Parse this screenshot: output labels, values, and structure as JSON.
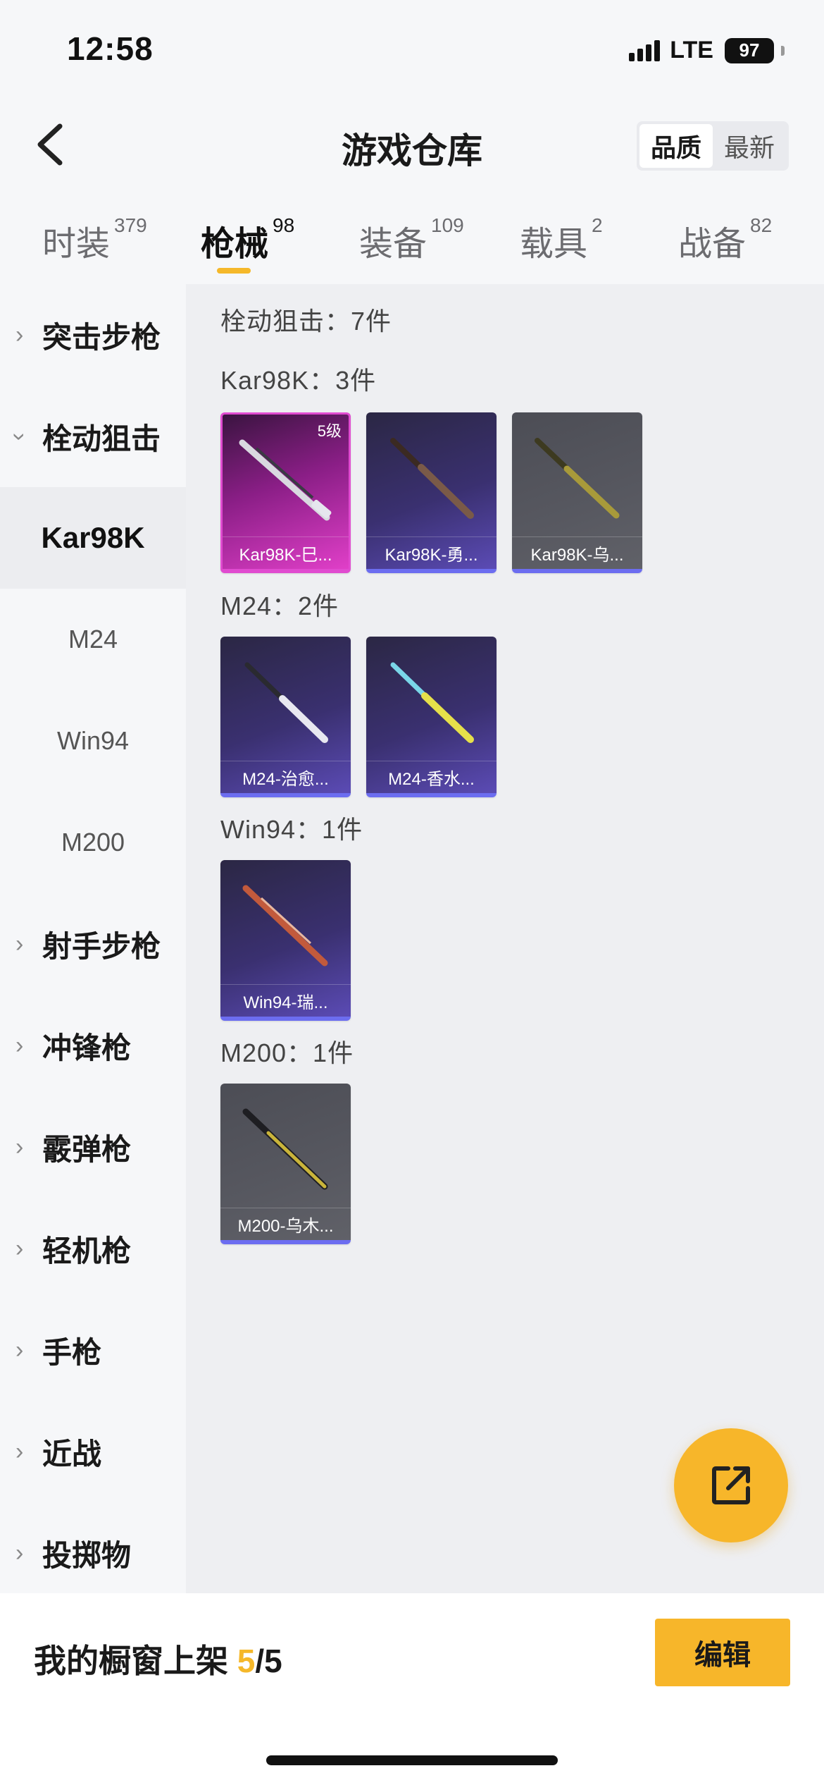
{
  "status": {
    "time": "12:58",
    "network": "LTE",
    "battery": "97"
  },
  "header": {
    "title": "游戏仓库",
    "sort_quality": "品质",
    "sort_latest": "最新"
  },
  "tabs": [
    {
      "label": "时装",
      "count": "379"
    },
    {
      "label": "枪械",
      "count": "98"
    },
    {
      "label": "装备",
      "count": "109"
    },
    {
      "label": "载具",
      "count": "2"
    },
    {
      "label": "战备",
      "count": "82"
    }
  ],
  "sidebar": {
    "assault": "突击步枪",
    "bolt": "栓动狙击",
    "sub_kar98k": "Kar98K",
    "sub_m24": "M24",
    "sub_win94": "Win94",
    "sub_m200": "M200",
    "marksman": "射手步枪",
    "smg": "冲锋枪",
    "shotgun": "霰弹枪",
    "lmg": "轻机枪",
    "pistol": "手枪",
    "melee": "近战",
    "throwable": "投掷物"
  },
  "content": {
    "category_heading": "栓动狙击：7件",
    "groups": [
      {
        "heading": "Kar98K：3件",
        "items": [
          {
            "name": "Kar98K-巳...",
            "level": "5级"
          },
          {
            "name": "Kar98K-勇..."
          },
          {
            "name": "Kar98K-乌..."
          }
        ]
      },
      {
        "heading": "M24：2件",
        "items": [
          {
            "name": "M24-治愈..."
          },
          {
            "name": "M24-香水..."
          }
        ]
      },
      {
        "heading": "Win94：1件",
        "items": [
          {
            "name": "Win94-瑞..."
          }
        ]
      },
      {
        "heading": "M200：1件",
        "items": [
          {
            "name": "M200-乌木..."
          }
        ]
      }
    ]
  },
  "bottom": {
    "showcase_label": "我的橱窗上架 ",
    "showcase_current": "5",
    "showcase_total": "/5",
    "edit": "编辑"
  },
  "colors": {
    "accent": "#f5b82a",
    "rare_border": "#6c6df0",
    "legendary_border": "#e04bd0"
  }
}
